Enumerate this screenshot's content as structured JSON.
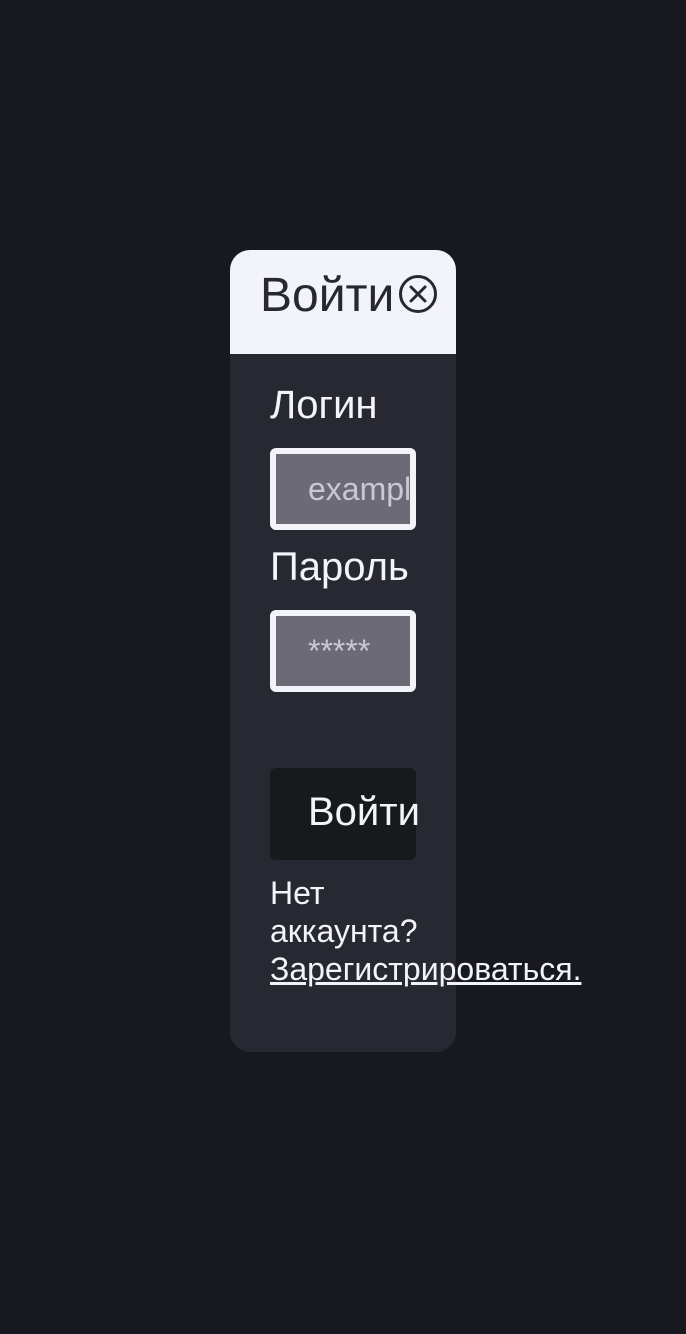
{
  "modal": {
    "title": "Войти",
    "close_icon": "close-circle-icon"
  },
  "form": {
    "login_label": "Логин",
    "login_placeholder": "example@mail.com",
    "password_label": "Пароль",
    "password_placeholder": "*****",
    "submit_label": "Войти",
    "no_account_text": "Нет аккаунта?",
    "register_link": "Зарегистрироваться."
  },
  "colors": {
    "page_background": "#181820",
    "modal_background": "#282833",
    "header_background": "#f3f4fa",
    "input_background": "#6b6a76",
    "button_background": "#161a1d",
    "text_light": "#f3f4fa",
    "text_dark": "#282833"
  }
}
